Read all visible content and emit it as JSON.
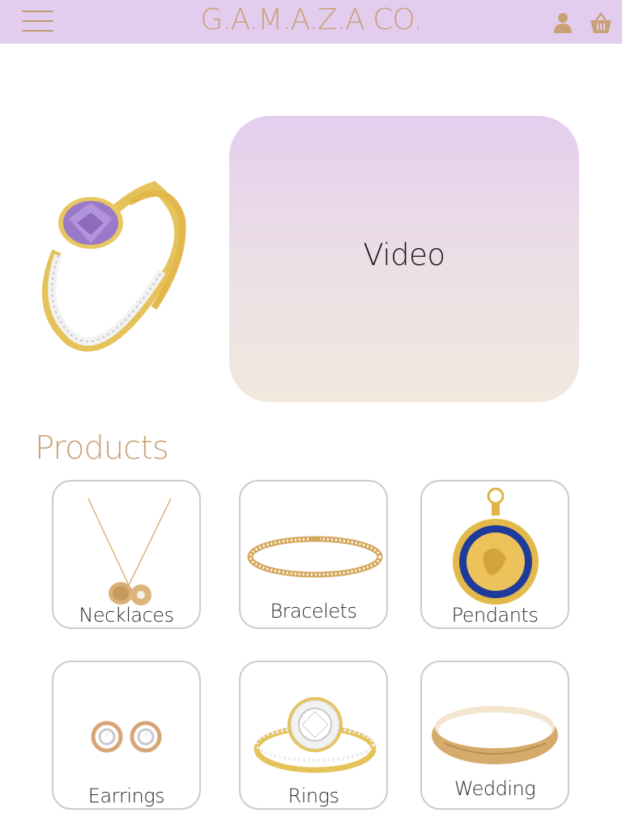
{
  "header": {
    "brand": "G.A.M.A.Z.A CO.",
    "menu_icon": "hamburger-menu-icon",
    "user_icon": "user-icon",
    "cart_icon": "shopping-basket-icon",
    "background": "#e3cdef",
    "accent": "#c9a177"
  },
  "hero": {
    "image": "amethyst-ring-image",
    "video_label": "Video"
  },
  "products": {
    "title": "Products",
    "items": [
      {
        "label": "Necklaces",
        "image": "necklace-image"
      },
      {
        "label": "Bracelets",
        "image": "bracelet-image"
      },
      {
        "label": "Pendants",
        "image": "pendant-image"
      },
      {
        "label": "Earrings",
        "image": "earrings-image"
      },
      {
        "label": "Rings",
        "image": "ring-image"
      },
      {
        "label": "Wedding",
        "image": "wedding-band-image"
      }
    ]
  }
}
